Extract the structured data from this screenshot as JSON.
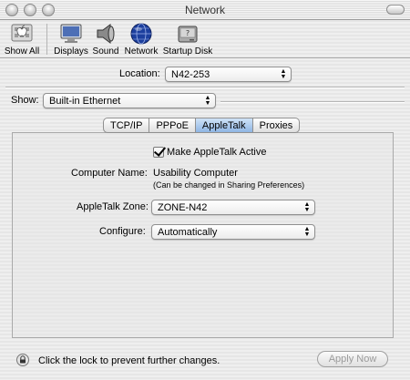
{
  "window": {
    "title": "Network"
  },
  "toolbar": {
    "items": [
      {
        "label": "Show All",
        "icon": "apple-icon"
      },
      {
        "label": "Displays",
        "icon": "display-icon"
      },
      {
        "label": "Sound",
        "icon": "speaker-icon"
      },
      {
        "label": "Network",
        "icon": "globe-icon"
      },
      {
        "label": "Startup Disk",
        "icon": "disk-icon"
      }
    ]
  },
  "location": {
    "label": "Location:",
    "value": "N42-253"
  },
  "show": {
    "label": "Show:",
    "value": "Built-in Ethernet"
  },
  "tabs": [
    {
      "label": "TCP/IP",
      "active": false
    },
    {
      "label": "PPPoE",
      "active": false
    },
    {
      "label": "AppleTalk",
      "active": true
    },
    {
      "label": "Proxies",
      "active": false
    }
  ],
  "appletalk": {
    "active_label": "Make AppleTalk Active",
    "active_checked": true,
    "computer_name_label": "Computer Name:",
    "computer_name_value": "Usability Computer",
    "computer_name_note": "(Can be changed in Sharing Preferences)",
    "zone_label": "AppleTalk Zone:",
    "zone_value": "ZONE-N42",
    "configure_label": "Configure:",
    "configure_value": "Automatically"
  },
  "footer": {
    "lock_text": "Click the lock to prevent further changes.",
    "apply_label": "Apply Now"
  },
  "colors": {
    "active_tab": "#8fb5e4",
    "globe": "#1c3f9e"
  }
}
